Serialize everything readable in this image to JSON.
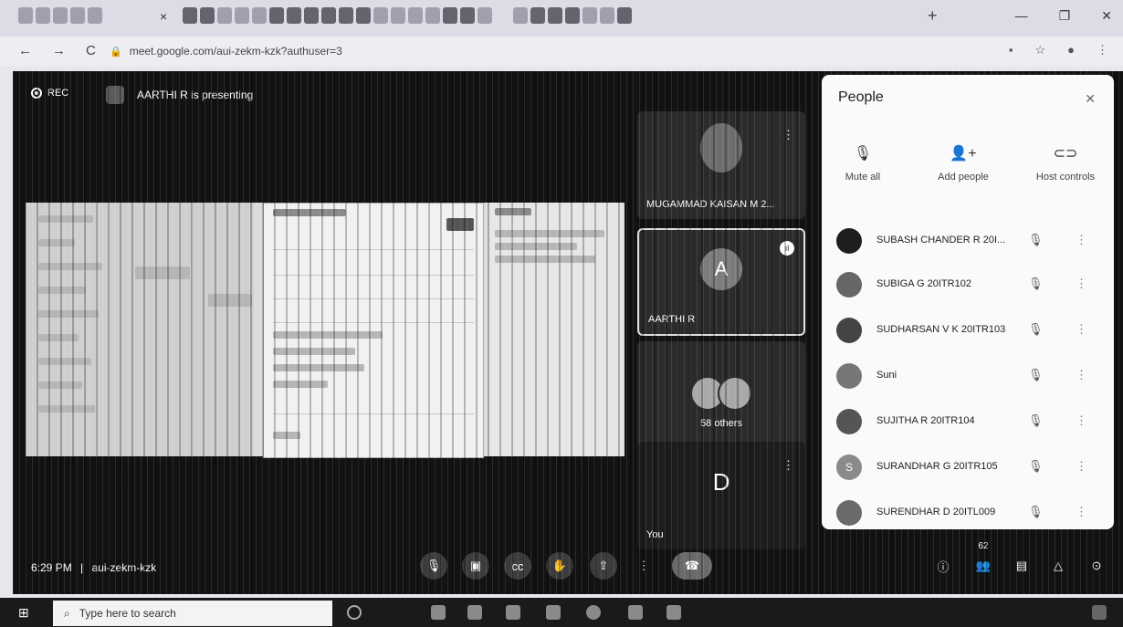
{
  "browser": {
    "url": "meet.google.com/aui-zekm-kzk?authuser=3",
    "tab_close_glyph": "×",
    "new_tab_glyph": "+",
    "window_controls": [
      "—",
      "❐",
      "✕"
    ],
    "nav_back": "←",
    "nav_forward": "→",
    "nav_reload": "C"
  },
  "meet": {
    "rec_label": "REC",
    "presenting_label": "AARTHI R is presenting",
    "tiles": [
      {
        "name": "MUGAMMAD KAISAN M 2..."
      },
      {
        "name": "AARTHI R",
        "letter": "A"
      },
      {
        "name": "58 others"
      },
      {
        "name": "You",
        "letter": "D"
      }
    ],
    "time": "6:29 PM",
    "meeting_code": "aui-zekm-kzk",
    "people_count": "62"
  },
  "people": {
    "title": "People",
    "actions": [
      {
        "label": "Mute all",
        "icon": "mic-off-icon"
      },
      {
        "label": "Add people",
        "icon": "add-person-icon"
      },
      {
        "label": "Host controls",
        "icon": "host-controls-icon"
      }
    ],
    "participants": [
      "SUBASH CHANDER R 20I...",
      "SUBIGA G 20ITR102",
      "SUDHARSAN V K 20ITR103",
      "Suni",
      "SUJITHA R 20ITR104",
      "SURANDHAR G 20ITR105",
      "SURENDHAR D 20ITL009"
    ],
    "participant_initial": "S"
  },
  "taskbar": {
    "search_placeholder": "Type here to search"
  }
}
